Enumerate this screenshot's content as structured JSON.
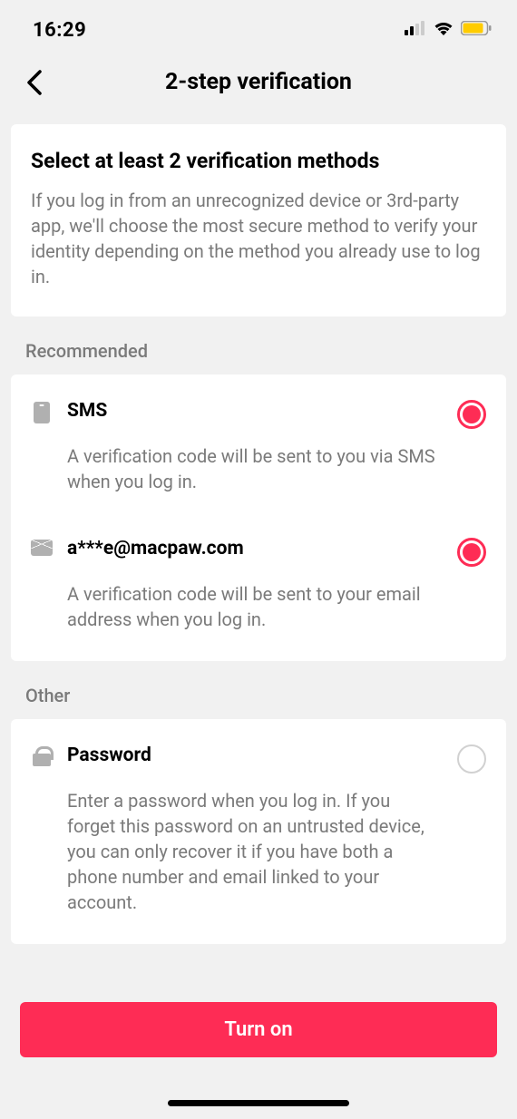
{
  "statusBar": {
    "time": "16:29"
  },
  "header": {
    "title": "2-step verification"
  },
  "intro": {
    "title": "Select at least 2 verification methods",
    "description": "If you log in from an unrecognized device or 3rd-party app, we'll choose the most secure method to verify your identity depending on the method you already use to log in."
  },
  "sections": {
    "recommended": {
      "label": "Recommended",
      "methods": [
        {
          "icon": "phone-icon",
          "title": "SMS",
          "description": "A verification code will be sent to you via SMS when you log in.",
          "selected": true
        },
        {
          "icon": "mail-icon",
          "title": "a***e@macpaw.com",
          "description": "A verification code will be sent to your email address when you log in.",
          "selected": true
        }
      ]
    },
    "other": {
      "label": "Other",
      "methods": [
        {
          "icon": "lock-icon",
          "title": "Password",
          "description": "Enter a password when you log in. If you forget this password on an untrusted device, you can only recover it if you have both a phone number and email linked to your account.",
          "selected": false
        }
      ]
    }
  },
  "primaryButton": {
    "label": "Turn on"
  },
  "colors": {
    "accent": "#fe2c55",
    "background": "#f1f1f1",
    "textSecondary": "#7a7a7a"
  }
}
